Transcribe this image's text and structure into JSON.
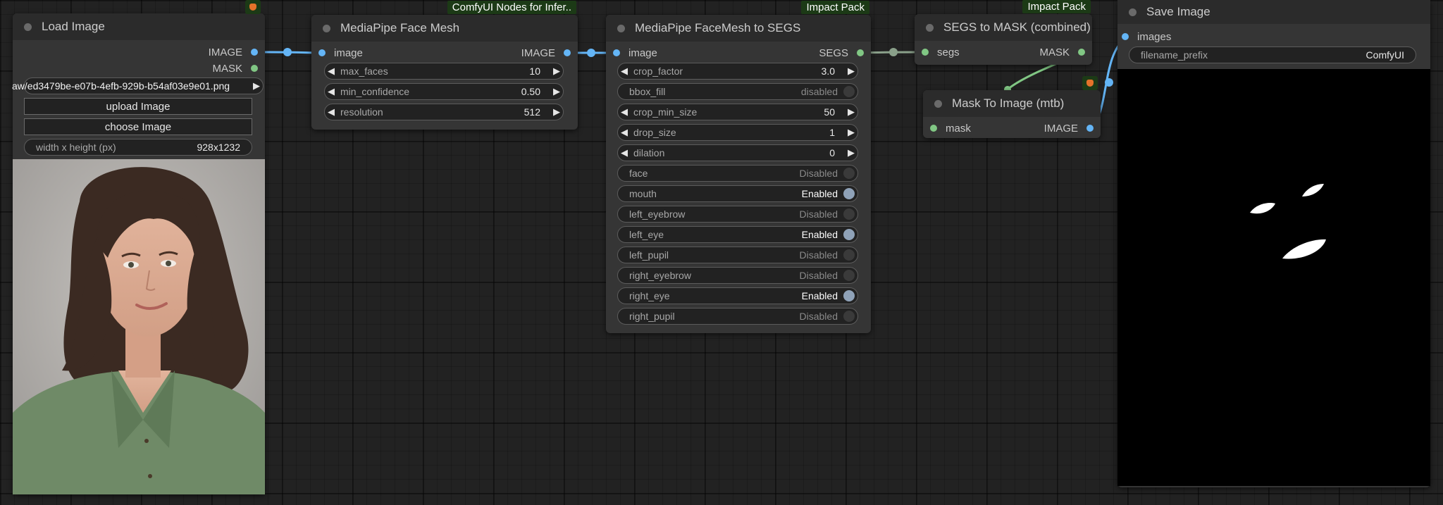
{
  "canvas": {
    "background": "#222222"
  },
  "colors": {
    "image_link": "#64b5f6",
    "mask_link": "#81c784",
    "segs_link": "#8aa08a",
    "badge_bg": "#1c3a16"
  },
  "load_image": {
    "title": "Load Image",
    "outputs": [
      "IMAGE",
      "MASK"
    ],
    "filename": "aw/ed3479be-e07b-4efb-929b-b54af03e9e01.png",
    "upload_label": "upload Image",
    "choose_label": "choose Image",
    "size_label": "width x height (px)",
    "size_value": "928x1232"
  },
  "face_mesh": {
    "title": "MediaPipe Face Mesh",
    "badge": "ComfyUI Nodes for Infer..",
    "input": "image",
    "output": "IMAGE",
    "widgets": [
      {
        "label": "max_faces",
        "value": "10"
      },
      {
        "label": "min_confidence",
        "value": "0.50"
      },
      {
        "label": "resolution",
        "value": "512"
      }
    ]
  },
  "to_segs": {
    "title": "MediaPipe FaceMesh to SEGS",
    "badge": "Impact Pack",
    "input": "image",
    "output": "SEGS",
    "numbers": [
      {
        "label": "crop_factor",
        "value": "3.0"
      },
      {
        "label": "drop_size",
        "value": "1"
      },
      {
        "label": "dilation",
        "value": "0"
      },
      {
        "label": "crop_min_size",
        "value": "50"
      }
    ],
    "bbox_fill": {
      "label": "bbox_fill",
      "value": "disabled"
    },
    "toggles": [
      {
        "label": "face",
        "value": "Disabled",
        "on": false
      },
      {
        "label": "mouth",
        "value": "Enabled",
        "on": true
      },
      {
        "label": "left_eyebrow",
        "value": "Disabled",
        "on": false
      },
      {
        "label": "left_eye",
        "value": "Enabled",
        "on": true
      },
      {
        "label": "left_pupil",
        "value": "Disabled",
        "on": false
      },
      {
        "label": "right_eyebrow",
        "value": "Disabled",
        "on": false
      },
      {
        "label": "right_eye",
        "value": "Enabled",
        "on": true
      },
      {
        "label": "right_pupil",
        "value": "Disabled",
        "on": false
      }
    ]
  },
  "segs_to_mask": {
    "title": "SEGS to MASK (combined)",
    "badge": "Impact Pack",
    "input": "segs",
    "output": "MASK"
  },
  "mask_to_image": {
    "title": "Mask To Image (mtb)",
    "input": "mask",
    "output": "IMAGE"
  },
  "save_image": {
    "title": "Save Image",
    "input": "images",
    "prefix_label": "filename_prefix",
    "prefix_value": "ComfyUI"
  }
}
